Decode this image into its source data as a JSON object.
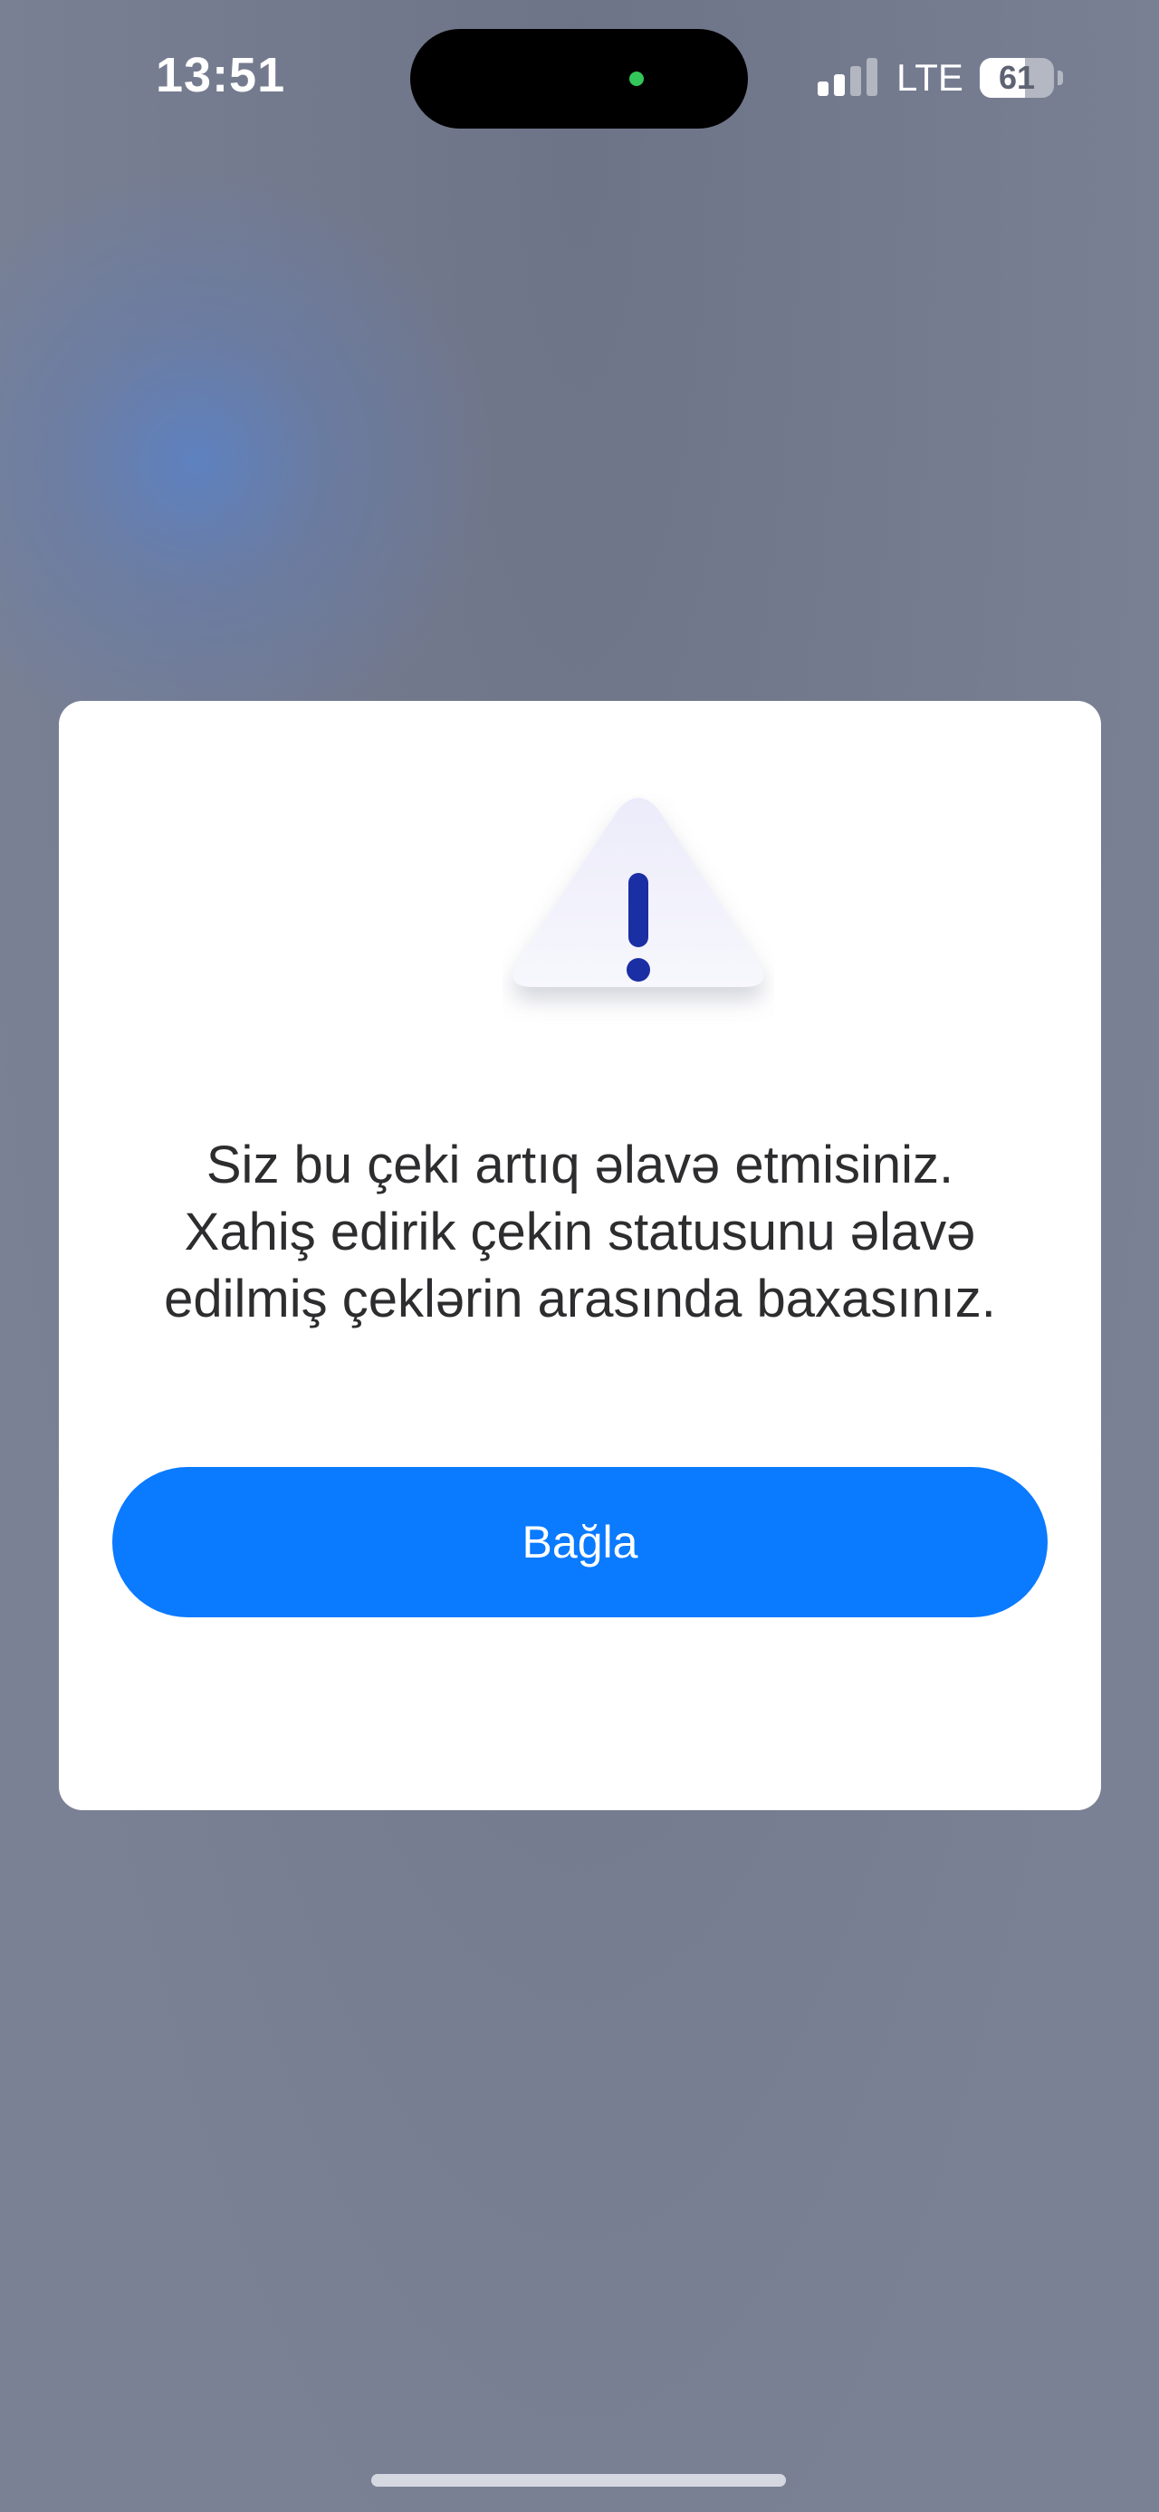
{
  "status_bar": {
    "time": "13:51",
    "network": "LTE",
    "battery_level": "61",
    "battery_fraction": 0.61,
    "signal_bars_active": 2,
    "signal_bars_total": 4,
    "camera_indicator_color": "#33c759"
  },
  "dialog": {
    "icon": "warning-triangle-icon",
    "icon_color": "#1a2fa3",
    "message_lines": [
      "Siz bu çeki artıq əlavə etmisiniz.",
      "Xahiş edirik çekin statusunu əlavə",
      "edilmiş çeklərin arasında baxasınız."
    ],
    "close_button_label": "Bağla",
    "button_color": "#0a7aff"
  }
}
